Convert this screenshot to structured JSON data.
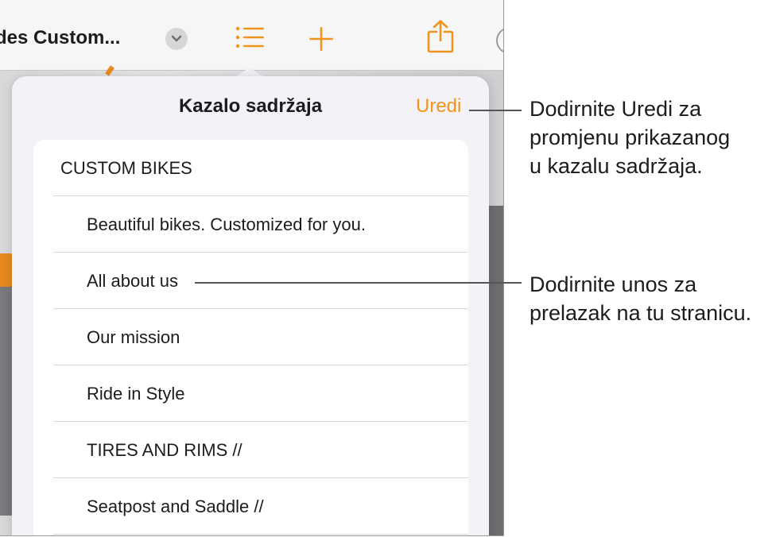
{
  "toolbar": {
    "doc_title": "des Custom...",
    "icons": [
      "chevron-down-icon",
      "list-icon",
      "plus-icon",
      "share-icon",
      "more-icon"
    ],
    "accent_color": "#f0941e"
  },
  "popover": {
    "title": "Kazalo sadržaja",
    "edit_label": "Uredi",
    "items": [
      {
        "label": "CUSTOM  BIKES",
        "level": 1
      },
      {
        "label": "Beautiful bikes. Customized for you.",
        "level": 2
      },
      {
        "label": "All about us",
        "level": 2
      },
      {
        "label": "Our mission",
        "level": 2
      },
      {
        "label": "Ride in Style",
        "level": 2
      },
      {
        "label": "TIRES AND RIMS //",
        "level": 2
      },
      {
        "label": "Seatpost and Saddle //",
        "level": 2
      }
    ]
  },
  "callouts": {
    "edit": [
      "Dodirnite Uredi za",
      "promjenu prikazanog",
      "u kazalu sadržaja."
    ],
    "entry": [
      "Dodirnite unos za",
      "prelazak na tu stranicu."
    ]
  }
}
